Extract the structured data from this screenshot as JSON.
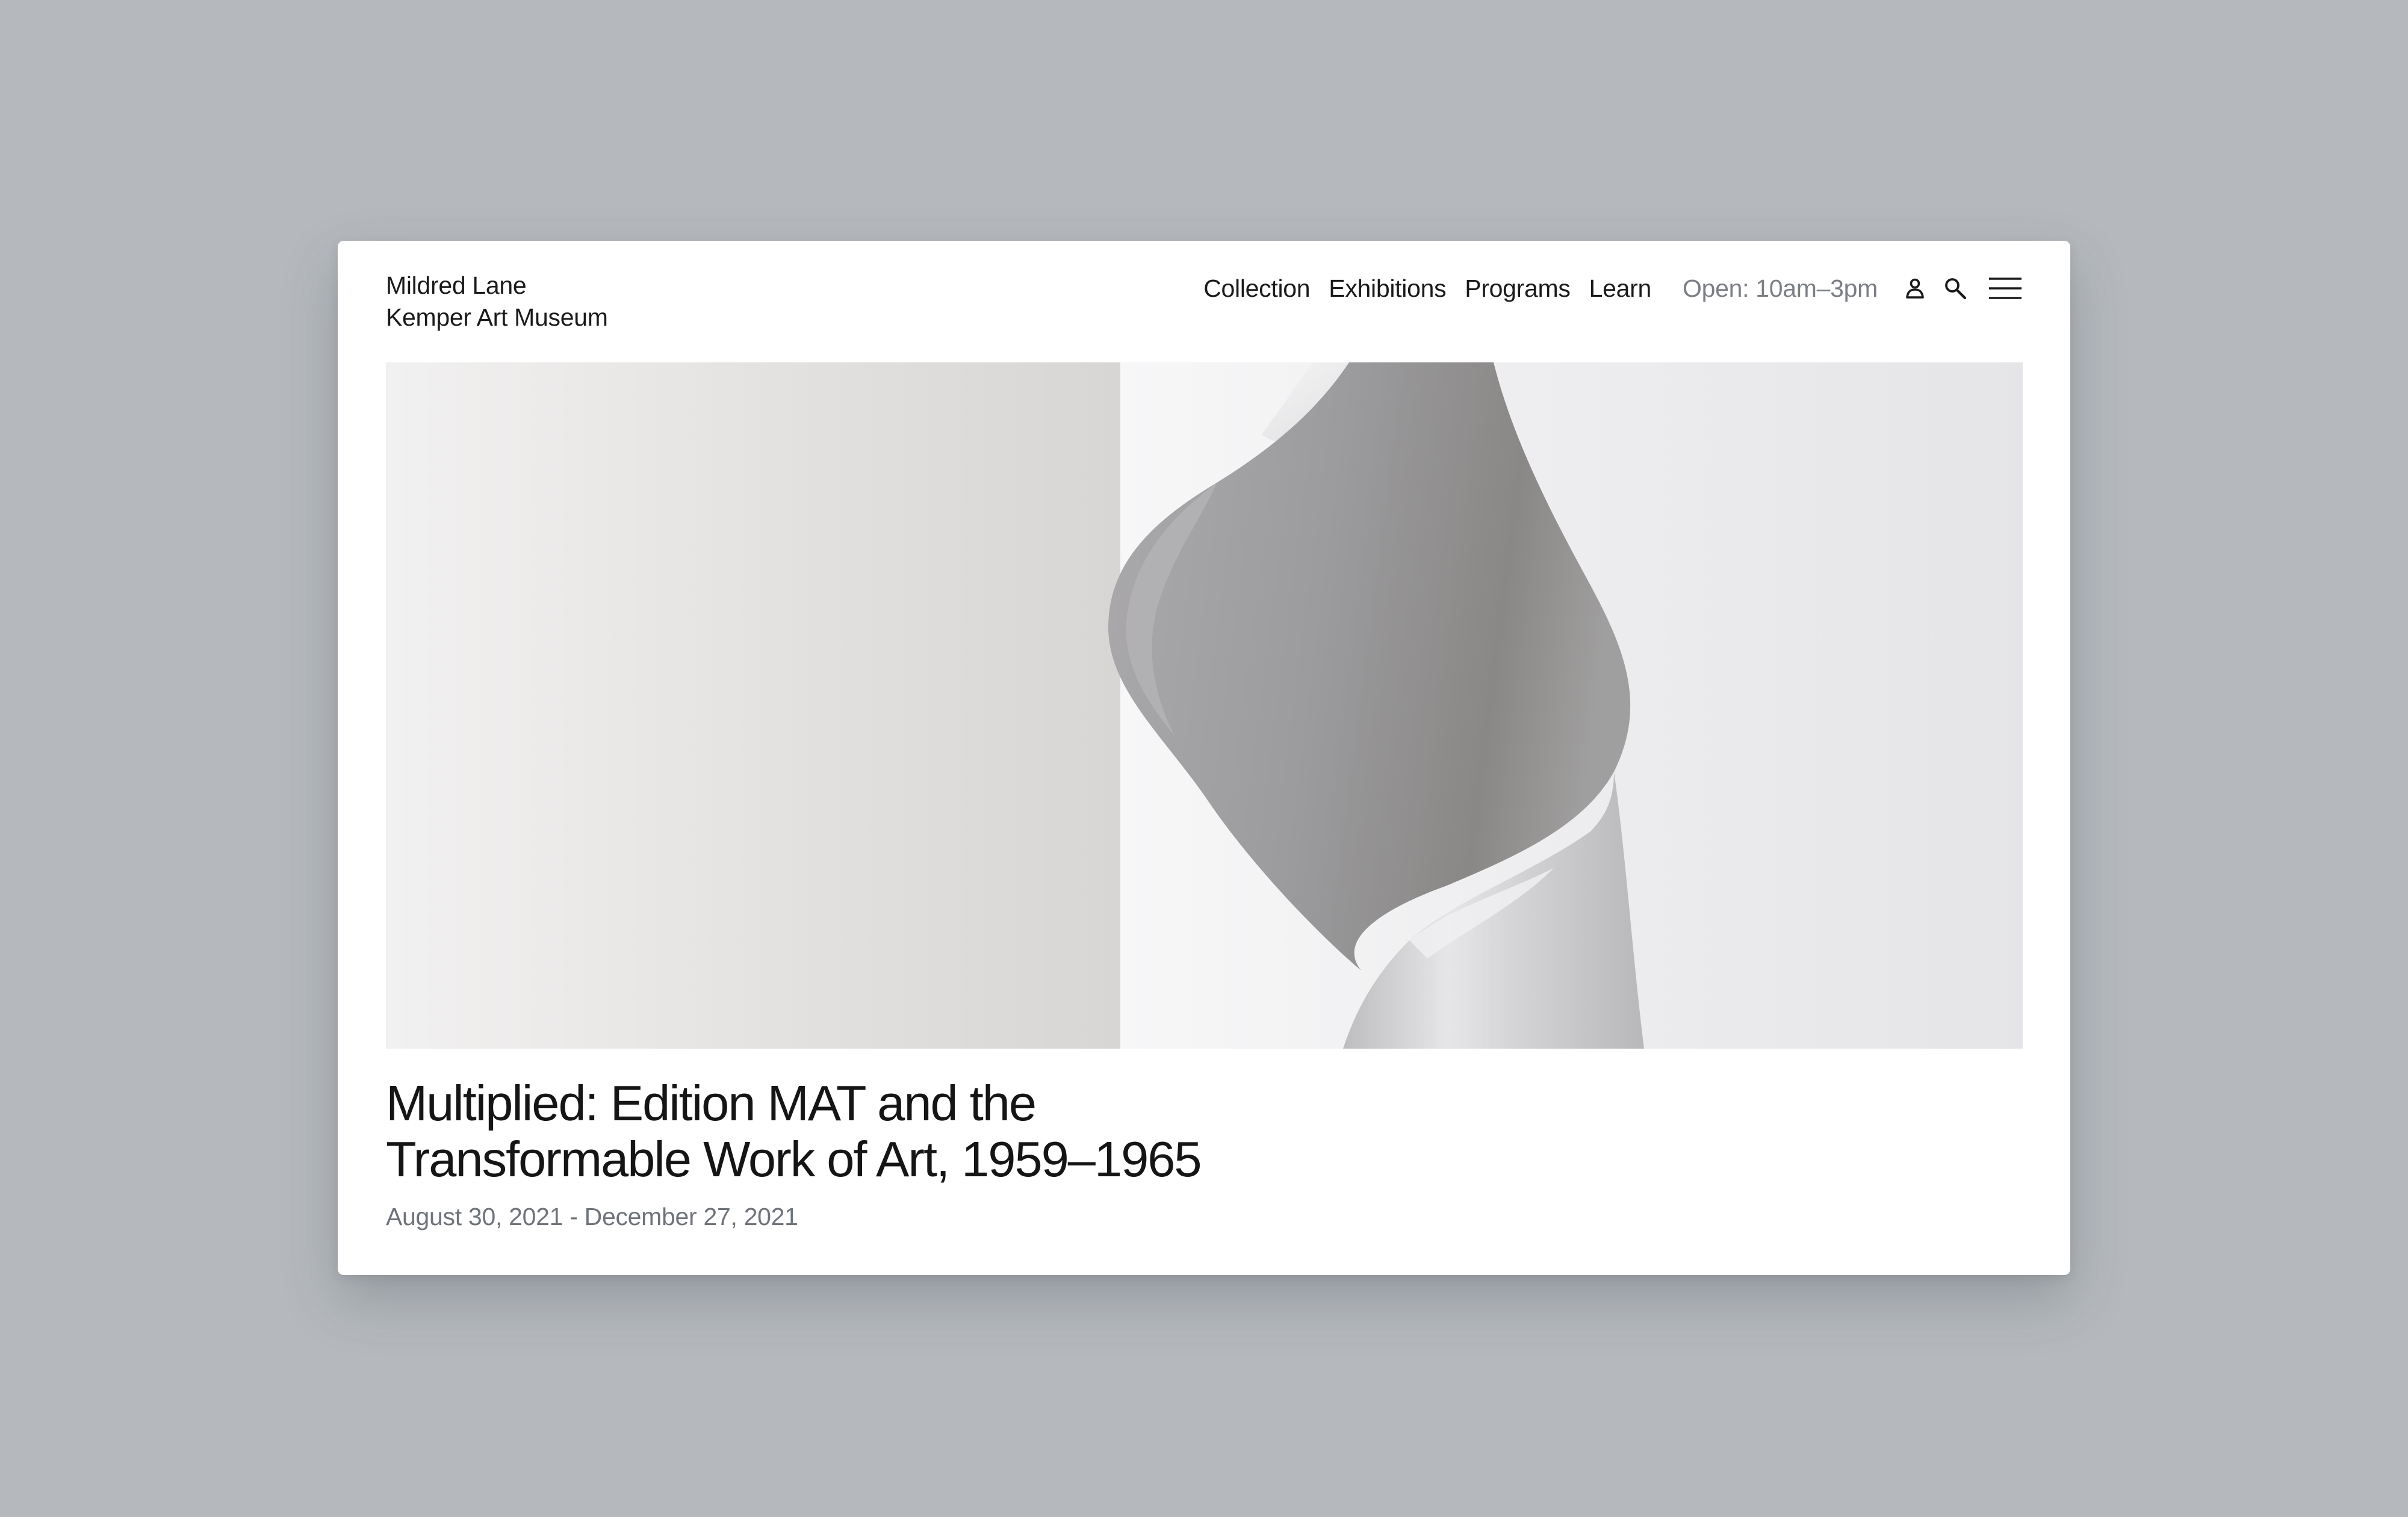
{
  "site": {
    "name_line1": "Mildred Lane",
    "name_line2": "Kemper Art Museum"
  },
  "nav": {
    "items": [
      {
        "label": "Collection"
      },
      {
        "label": "Exhibitions"
      },
      {
        "label": "Programs"
      },
      {
        "label": "Learn"
      }
    ],
    "hours": "Open: 10am–3pm",
    "icons": [
      "user-icon",
      "search-icon",
      "menu-icon"
    ]
  },
  "hero": {
    "image": "hero-image"
  },
  "exhibition": {
    "title_line1": "Multiplied: Edition MAT and the",
    "title_line2": "Transformable Work of Art, 1959–1965",
    "dates": "August 30, 2021 - December 27, 2021"
  },
  "colors": {
    "page_background": "#b5b9bd",
    "card_background": "#ffffff",
    "text_primary": "#1a1a1a",
    "text_muted": "#7b7f85"
  }
}
